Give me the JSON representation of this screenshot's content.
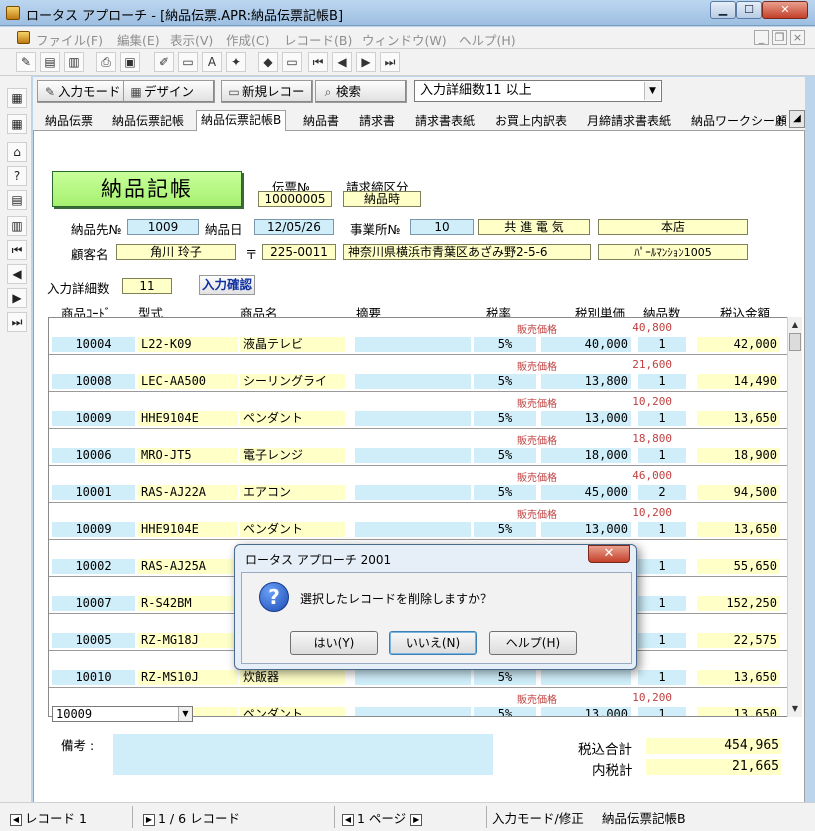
{
  "window": {
    "title": "ロータス アプローチ - [納品伝票.APR:納品伝票記帳B]"
  },
  "menu": [
    {
      "label": "ファイル(F)"
    },
    {
      "label": "編集(E)"
    },
    {
      "label": "表示(V)"
    },
    {
      "label": "作成(C)"
    },
    {
      "label": "レコード(B)"
    },
    {
      "label": "ウィンドウ(W)"
    },
    {
      "label": "ヘルプ(H)"
    }
  ],
  "modebar": {
    "input_mode": "入力モード",
    "design": "デザイン",
    "new_record": "新規レコード",
    "search": "検索",
    "view_select": "入力詳細数11 以上"
  },
  "tabs": [
    "納品伝票",
    "納品伝票記帳",
    "納品伝票記帳B",
    "納品書",
    "請求書",
    "請求書表紙",
    "お買上内訳表",
    "月締請求書表紙",
    "納品ワークシート",
    "顧"
  ],
  "form": {
    "title": "納品記帳",
    "slip_no_label": "伝票№",
    "slip_no": "10000005",
    "billing_label": "請求締区分",
    "billing_value": "納品時",
    "delivery_to_label": "納品先№",
    "delivery_to": "1009",
    "delivery_date_label": "納品日",
    "delivery_date": "12/05/26",
    "office_label": "事業所№",
    "office_no": "10",
    "office_name": "共 進 電 気",
    "branch": "本店",
    "customer_label": "顧客名",
    "customer_name": "角川 玲子",
    "postal_mark": "〒",
    "postal": "225-0011",
    "address": "神奈川県横浜市青葉区あざみ野2-5-6",
    "building": "ﾊﾟｰﾙﾏﾝｼｮﾝ1005",
    "detail_count_label": "入力詳細数",
    "detail_count": "11",
    "confirm_button": "入力確認"
  },
  "columns": [
    "商品ｺｰﾄﾞ",
    "型式",
    "商品名",
    "摘要",
    "税率",
    "税別単価",
    "納品数",
    "税込金額"
  ],
  "rows": [
    {
      "code": "10004",
      "model": "L22-K09",
      "name": "液晶テレビ",
      "tax": "5%",
      "list_label": "販売価格",
      "list_price": "40,800",
      "unit": "40,000",
      "qty": "1",
      "amount": "42,000"
    },
    {
      "code": "10008",
      "model": "LEC-AA500",
      "name": "シーリングライ",
      "tax": "5%",
      "list_label": "販売価格",
      "list_price": "21,600",
      "unit": "13,800",
      "qty": "1",
      "amount": "14,490"
    },
    {
      "code": "10009",
      "model": "HHE9104E",
      "name": "ペンダント",
      "tax": "5%",
      "list_label": "販売価格",
      "list_price": "10,200",
      "unit": "13,000",
      "qty": "1",
      "amount": "13,650"
    },
    {
      "code": "10006",
      "model": "MRO-JT5",
      "name": "電子レンジ",
      "tax": "5%",
      "list_label": "販売価格",
      "list_price": "18,800",
      "unit": "18,000",
      "qty": "1",
      "amount": "18,900"
    },
    {
      "code": "10001",
      "model": "RAS-AJ22A",
      "name": "エアコン",
      "tax": "5%",
      "list_label": "販売価格",
      "list_price": "46,000",
      "unit": "45,000",
      "qty": "2",
      "amount": "94,500"
    },
    {
      "code": "10009",
      "model": "HHE9104E",
      "name": "ペンダント",
      "tax": "5%",
      "list_label": "販売価格",
      "list_price": "10,200",
      "unit": "13,000",
      "qty": "1",
      "amount": "13,650"
    },
    {
      "code": "10002",
      "model": "RAS-AJ25A",
      "name": "",
      "tax": "",
      "list_label": "",
      "list_price": "",
      "unit": "",
      "qty": "1",
      "amount": "55,650"
    },
    {
      "code": "10007",
      "model": "R-S42BM",
      "name": "",
      "tax": "",
      "list_label": "",
      "list_price": "",
      "unit": "",
      "qty": "1",
      "amount": "152,250"
    },
    {
      "code": "10005",
      "model": "RZ-MG18J",
      "name": "",
      "tax": "",
      "list_label": "",
      "list_price": "",
      "unit": "",
      "qty": "1",
      "amount": "22,575"
    },
    {
      "code": "10010",
      "model": "RZ-MS10J",
      "name": "炊飯器",
      "tax": "5%",
      "list_label": "",
      "list_price": "",
      "unit": "",
      "qty": "1",
      "amount": "13,650"
    },
    {
      "code": "10009",
      "model": "",
      "name": "ペンダント",
      "tax": "5%",
      "list_label": "販売価格",
      "list_price": "10,200",
      "unit": "13,000",
      "qty": "1",
      "amount": "13,650"
    }
  ],
  "footer": {
    "remarks_label": "備考 :",
    "total_label": "税込合計",
    "total": "454,965",
    "tax_label": "内税計",
    "tax_total": "21,665"
  },
  "status": {
    "record": "レコード 1",
    "count": "1 / 6 レコード",
    "page": "1 ページ",
    "mode": "入力モード/修正",
    "view": "納品伝票記帳B"
  },
  "dialog": {
    "title": "ロータス アプローチ 2001",
    "message": "選択したレコードを削除しますか？",
    "yes": "はい(Y)",
    "no": "いいえ(N)",
    "help": "ヘルプ(H)"
  },
  "colors": {
    "yellow_field": "#ffffc8",
    "blue_field": "#cfeefa",
    "title_green": "#b4f884",
    "price_red": "#c04040"
  }
}
